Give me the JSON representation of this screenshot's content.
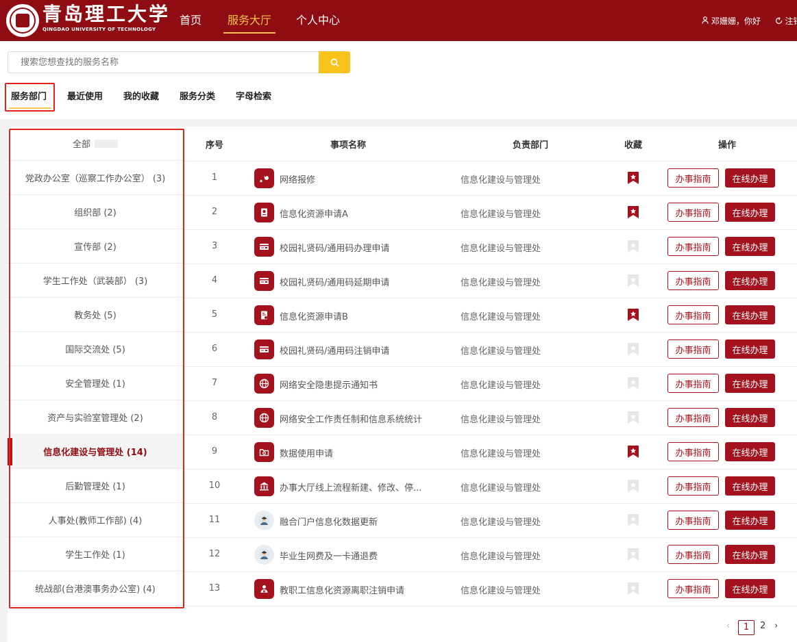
{
  "header": {
    "title": "青岛理工大学",
    "subtitle": "QINGDAO UNIVERSITY OF TECHNOLOGY",
    "nav": [
      "首页",
      "服务大厅",
      "个人中心"
    ],
    "greeting": "邓姗姗，你好",
    "logout": "注销"
  },
  "search": {
    "placeholder": "搜索您想查找的服务名称"
  },
  "tabs": [
    "服务部门",
    "最近使用",
    "我的收藏",
    "服务分类",
    "字母检索"
  ],
  "departments": {
    "all": "全部",
    "items": [
      "党政办公室（巡察工作办公室） (3)",
      "组织部 (2)",
      "宣传部 (2)",
      "学生工作处（武装部） (3)",
      "教务处 (5)",
      "国际交流处 (5)",
      "安全管理处 (1)",
      "资产与实验室管理处 (2)",
      "信息化建设与管理处 (14)",
      "后勤管理处 (1)",
      "人事处(教师工作部) (4)",
      "学生工作处 (1)",
      "统战部(台港澳事务办公室) (4)"
    ]
  },
  "table": {
    "headers": [
      "序号",
      "事项名称",
      "负责部门",
      "收藏",
      "操作"
    ],
    "guide_label": "办事指南",
    "online_label": "在线办理",
    "rows": [
      {
        "no": "1",
        "name": "网络报修",
        "dept": "信息化建设与管理处",
        "fav": true,
        "icon": "wrench-icon"
      },
      {
        "no": "2",
        "name": "信息化资源申请A",
        "dept": "信息化建设与管理处",
        "fav": true,
        "icon": "passport-icon"
      },
      {
        "no": "3",
        "name": "校园礼贤码/通用码办理申请",
        "dept": "信息化建设与管理处",
        "fav": false,
        "icon": "card-icon"
      },
      {
        "no": "4",
        "name": "校园礼贤码/通用码延期申请",
        "dept": "信息化建设与管理处",
        "fav": false,
        "icon": "card-icon"
      },
      {
        "no": "5",
        "name": "信息化资源申请B",
        "dept": "信息化建设与管理处",
        "fav": true,
        "icon": "document-icon"
      },
      {
        "no": "6",
        "name": "校园礼贤码/通用码注销申请",
        "dept": "信息化建设与管理处",
        "fav": false,
        "icon": "card-icon"
      },
      {
        "no": "7",
        "name": "网络安全隐患提示通知书",
        "dept": "信息化建设与管理处",
        "fav": false,
        "icon": "globe-icon"
      },
      {
        "no": "8",
        "name": "网络安全工作责任制和信息系统统计",
        "dept": "信息化建设与管理处",
        "fav": false,
        "icon": "globe-icon"
      },
      {
        "no": "9",
        "name": "数据使用申请",
        "dept": "信息化建设与管理处",
        "fav": true,
        "icon": "folder-icon"
      },
      {
        "no": "10",
        "name": "办事大厅线上流程新建、修改、停...",
        "dept": "信息化建设与管理处",
        "fav": false,
        "icon": "building-icon"
      },
      {
        "no": "11",
        "name": "融合门户信息化数据更新",
        "dept": "信息化建设与管理处",
        "fav": false,
        "icon": "avatar-icon"
      },
      {
        "no": "12",
        "name": "毕业生网费及一卡通退费",
        "dept": "信息化建设与管理处",
        "fav": false,
        "icon": "avatar-icon"
      },
      {
        "no": "13",
        "name": "教职工信息化资源离职注销申请",
        "dept": "信息化建设与管理处",
        "fav": false,
        "icon": "user-remove-icon"
      }
    ]
  },
  "pagination": {
    "current": "1",
    "next_page": "2"
  },
  "colors": {
    "brand": "#8f0c12",
    "accent": "#f6c54a",
    "button": "#a3121d",
    "highlight_box": "#e2231a"
  }
}
